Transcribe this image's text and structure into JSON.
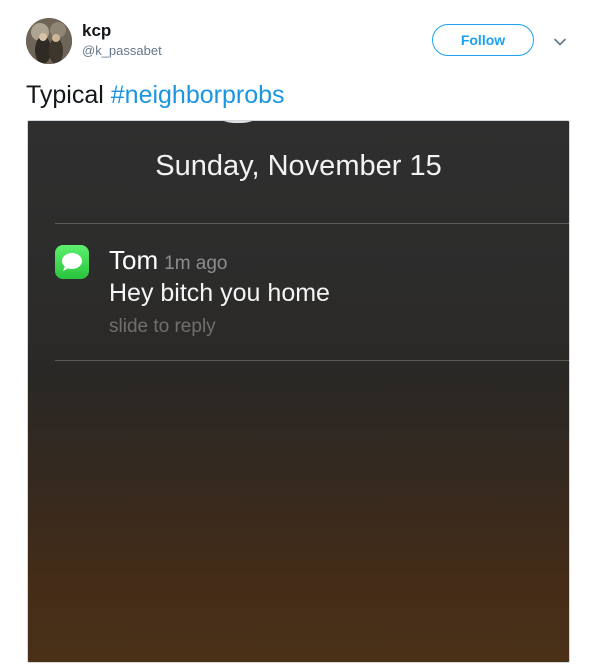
{
  "tweet": {
    "author": {
      "display_name": "kcp",
      "handle": "@k_passabet"
    },
    "follow_label": "Follow",
    "text_prefix": "Typical ",
    "hashtag": "#neighborprobs"
  },
  "screenshot": {
    "date": "Sunday, November 15",
    "notification": {
      "app_icon": "messages-icon",
      "sender": "Tom",
      "time": "1m ago",
      "message": "Hey bitch you home",
      "hint": "slide to reply"
    }
  },
  "colors": {
    "twitter_blue": "#1da1f2",
    "hashtag_blue": "#1b95e0",
    "messages_green": "#34c759"
  }
}
